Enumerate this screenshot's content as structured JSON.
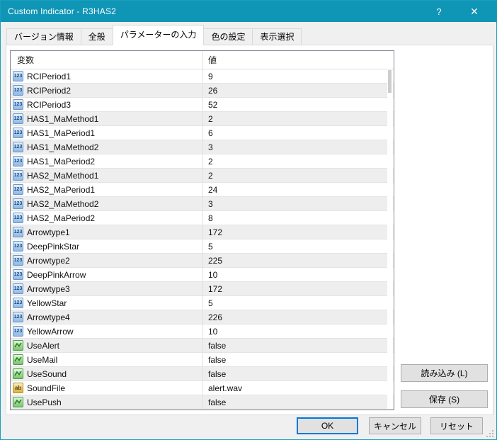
{
  "window": {
    "title": "Custom Indicator - R3HAS2",
    "help": "?",
    "close": "✕"
  },
  "tabs": [
    {
      "label": "バージョン情報",
      "active": false
    },
    {
      "label": "全般",
      "active": false
    },
    {
      "label": "パラメーターの入力",
      "active": true
    },
    {
      "label": "色の設定",
      "active": false
    },
    {
      "label": "表示選択",
      "active": false
    }
  ],
  "table": {
    "columns": {
      "variable": "変数",
      "value": "値"
    },
    "rows": [
      {
        "name": "RCIPeriod1",
        "value": "9",
        "type": "int"
      },
      {
        "name": "RCIPeriod2",
        "value": "26",
        "type": "int"
      },
      {
        "name": "RCIPeriod3",
        "value": "52",
        "type": "int"
      },
      {
        "name": "HAS1_MaMethod1",
        "value": "2",
        "type": "int"
      },
      {
        "name": "HAS1_MaPeriod1",
        "value": "6",
        "type": "int"
      },
      {
        "name": "HAS1_MaMethod2",
        "value": "3",
        "type": "int"
      },
      {
        "name": "HAS1_MaPeriod2",
        "value": "2",
        "type": "int"
      },
      {
        "name": "HAS2_MaMethod1",
        "value": "2",
        "type": "int"
      },
      {
        "name": "HAS2_MaPeriod1",
        "value": "24",
        "type": "int"
      },
      {
        "name": "HAS2_MaMethod2",
        "value": "3",
        "type": "int"
      },
      {
        "name": "HAS2_MaPeriod2",
        "value": "8",
        "type": "int"
      },
      {
        "name": "Arrowtype1",
        "value": "172",
        "type": "int"
      },
      {
        "name": "DeepPinkStar",
        "value": "5",
        "type": "int"
      },
      {
        "name": "Arrowtype2",
        "value": "225",
        "type": "int"
      },
      {
        "name": "DeepPinkArrow",
        "value": "10",
        "type": "int"
      },
      {
        "name": "Arrowtype3",
        "value": "172",
        "type": "int"
      },
      {
        "name": "YellowStar",
        "value": "5",
        "type": "int"
      },
      {
        "name": "Arrowtype4",
        "value": "226",
        "type": "int"
      },
      {
        "name": "YellowArrow",
        "value": "10",
        "type": "int"
      },
      {
        "name": "UseAlert",
        "value": "false",
        "type": "bool"
      },
      {
        "name": "UseMail",
        "value": "false",
        "type": "bool"
      },
      {
        "name": "UseSound",
        "value": "false",
        "type": "bool"
      },
      {
        "name": "SoundFile",
        "value": "alert.wav",
        "type": "string"
      },
      {
        "name": "UsePush",
        "value": "false",
        "type": "bool"
      }
    ]
  },
  "icons": {
    "int": "123",
    "string": "ab"
  },
  "buttons": {
    "load": "読み込み (L)",
    "save": "保存 (S)",
    "ok": "OK",
    "cancel": "キャンセル",
    "reset": "リセット"
  },
  "colors": {
    "titlebar": "#0f95b5",
    "focus": "#0078d7",
    "row_alt": "#eeeeee"
  }
}
